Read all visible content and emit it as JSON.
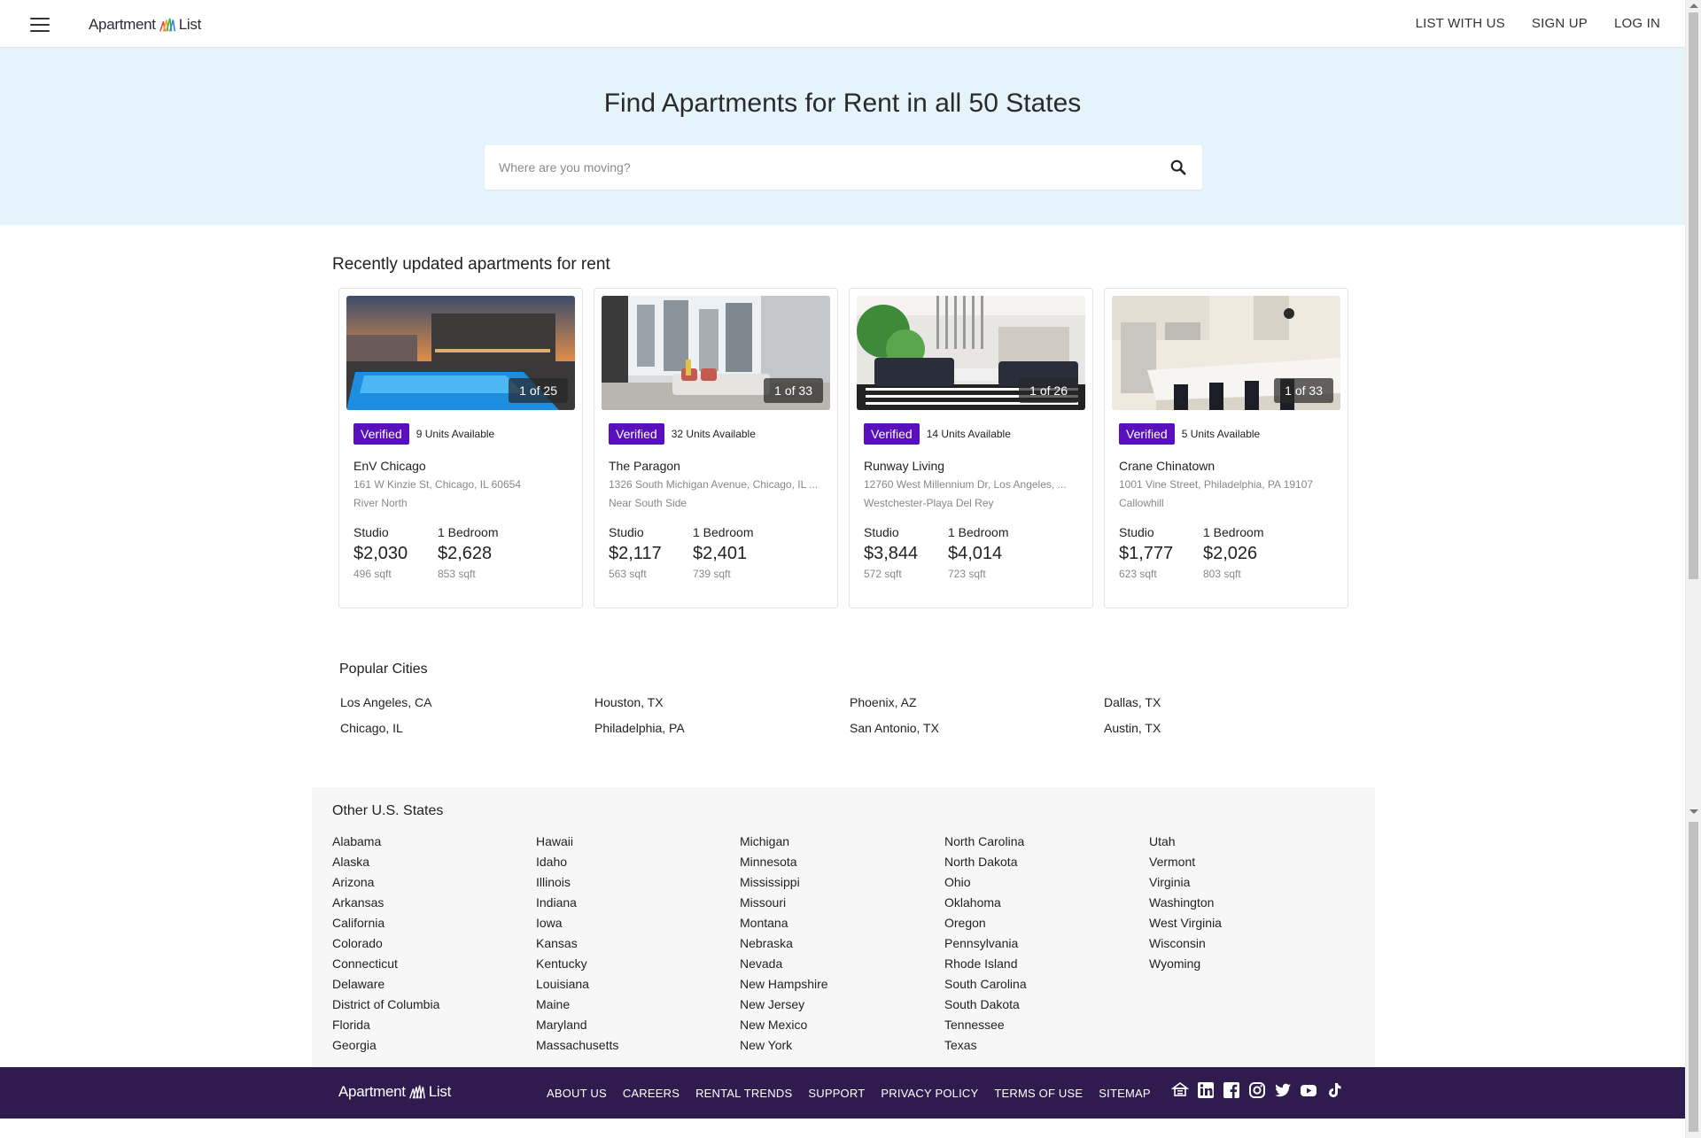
{
  "header": {
    "logo_left": "Apartment",
    "logo_right": "List",
    "nav": [
      "LIST WITH US",
      "SIGN UP",
      "LOG IN"
    ]
  },
  "hero": {
    "title": "Find Apartments for Rent in all 50 States",
    "search_placeholder": "Where are you moving?"
  },
  "listings": {
    "title": "Recently updated apartments for rent",
    "verified_label": "Verified",
    "cards": [
      {
        "photo_count": "1 of 25",
        "units": "9 Units Available",
        "name": "EnV Chicago",
        "address": "161 W Kinzie St, Chicago, IL 60654",
        "neighborhood": "River North",
        "p1": {
          "bed": "Studio",
          "price": "$2,030",
          "sqft": "496 sqft"
        },
        "p2": {
          "bed": "1 Bedroom",
          "price": "$2,628",
          "sqft": "853 sqft"
        }
      },
      {
        "photo_count": "1 of 33",
        "units": "32 Units Available",
        "name": "The Paragon",
        "address": "1326 South Michigan Avenue, Chicago, IL ...",
        "neighborhood": "Near South Side",
        "p1": {
          "bed": "Studio",
          "price": "$2,117",
          "sqft": "563 sqft"
        },
        "p2": {
          "bed": "1 Bedroom",
          "price": "$2,401",
          "sqft": "739 sqft"
        }
      },
      {
        "photo_count": "1 of 26",
        "units": "14 Units Available",
        "name": "Runway Living",
        "address": "12760 West Millennium Dr, Los Angeles, ...",
        "neighborhood": "Westchester-Playa Del Rey",
        "p1": {
          "bed": "Studio",
          "price": "$3,844",
          "sqft": "572 sqft"
        },
        "p2": {
          "bed": "1 Bedroom",
          "price": "$4,014",
          "sqft": "723 sqft"
        }
      },
      {
        "photo_count": "1 of 33",
        "units": "5 Units Available",
        "name": "Crane Chinatown",
        "address": "1001 Vine Street, Philadelphia, PA 19107",
        "neighborhood": "Callowhill",
        "p1": {
          "bed": "Studio",
          "price": "$1,777",
          "sqft": "623 sqft"
        },
        "p2": {
          "bed": "1 Bedroom",
          "price": "$2,026",
          "sqft": "803 sqft"
        }
      }
    ]
  },
  "popular": {
    "title": "Popular Cities",
    "cities": [
      "Los Angeles, CA",
      "Houston, TX",
      "Phoenix, AZ",
      "Dallas, TX",
      "Chicago, IL",
      "Philadelphia, PA",
      "San Antonio, TX",
      "Austin, TX"
    ]
  },
  "states": {
    "title": "Other U.S. States",
    "columns": [
      [
        "Alabama",
        "Alaska",
        "Arizona",
        "Arkansas",
        "California",
        "Colorado",
        "Connecticut",
        "Delaware",
        "District of Columbia",
        "Florida",
        "Georgia"
      ],
      [
        "Hawaii",
        "Idaho",
        "Illinois",
        "Indiana",
        "Iowa",
        "Kansas",
        "Kentucky",
        "Louisiana",
        "Maine",
        "Maryland",
        "Massachusetts"
      ],
      [
        "Michigan",
        "Minnesota",
        "Mississippi",
        "Missouri",
        "Montana",
        "Nebraska",
        "Nevada",
        "New Hampshire",
        "New Jersey",
        "New Mexico",
        "New York"
      ],
      [
        "North Carolina",
        "North Dakota",
        "Ohio",
        "Oklahoma",
        "Oregon",
        "Pennsylvania",
        "Rhode Island",
        "South Carolina",
        "South Dakota",
        "Tennessee",
        "Texas"
      ],
      [
        "Utah",
        "Vermont",
        "Virginia",
        "Washington",
        "West Virginia",
        "Wisconsin",
        "Wyoming"
      ]
    ]
  },
  "footer": {
    "logo_left": "Apartment",
    "logo_right": "List",
    "links": [
      "ABOUT US",
      "CAREERS",
      "RENTAL TRENDS",
      "SUPPORT",
      "PRIVACY POLICY",
      "TERMS OF USE",
      "SITEMAP"
    ],
    "social_icons": [
      "equal-housing-icon",
      "linkedin-icon",
      "facebook-icon",
      "instagram-icon",
      "twitter-icon",
      "youtube-icon",
      "tiktok-icon"
    ]
  },
  "colors": {
    "hero_bg": "#e5f4fb",
    "verified": "#5a0fbf",
    "footer_bg": "#2f1b4e"
  }
}
